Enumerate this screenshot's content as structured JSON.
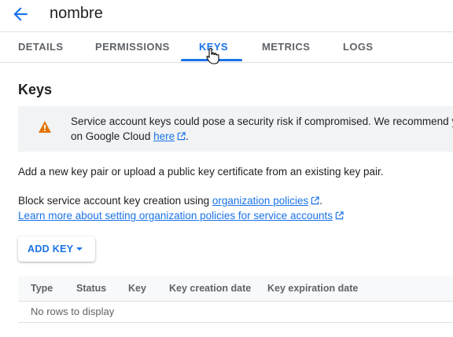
{
  "header": {
    "title": "nombre",
    "back_icon": "arrow-back-icon"
  },
  "tabs": [
    {
      "label": "DETAILS",
      "active": false
    },
    {
      "label": "PERMISSIONS",
      "active": false
    },
    {
      "label": "KEYS",
      "active": true
    },
    {
      "label": "METRICS",
      "active": false
    },
    {
      "label": "LOGS",
      "active": false
    }
  ],
  "section": {
    "title": "Keys"
  },
  "banner": {
    "icon": "warning-icon",
    "line1": "Service account keys could pose a security risk if compromised. We recommend you",
    "line2_prefix": "on Google Cloud",
    "line2_link": "here",
    "line2_suffix": "."
  },
  "info": {
    "add_text": "Add a new key pair or upload a public key certificate from an existing key pair.",
    "block_prefix": "Block service account key creation using",
    "block_link": "organization policies",
    "block_suffix": ".",
    "learn_link": "Learn more about setting organization policies for service accounts"
  },
  "add_key_button": {
    "label": "ADD KEY"
  },
  "table": {
    "columns": [
      "Type",
      "Status",
      "Key",
      "Key creation date",
      "Key expiration date"
    ],
    "empty_message": "No rows to display"
  },
  "colors": {
    "accent": "#1a73e8",
    "warning": "#e37400",
    "banner_bg": "#f1f3f4"
  }
}
